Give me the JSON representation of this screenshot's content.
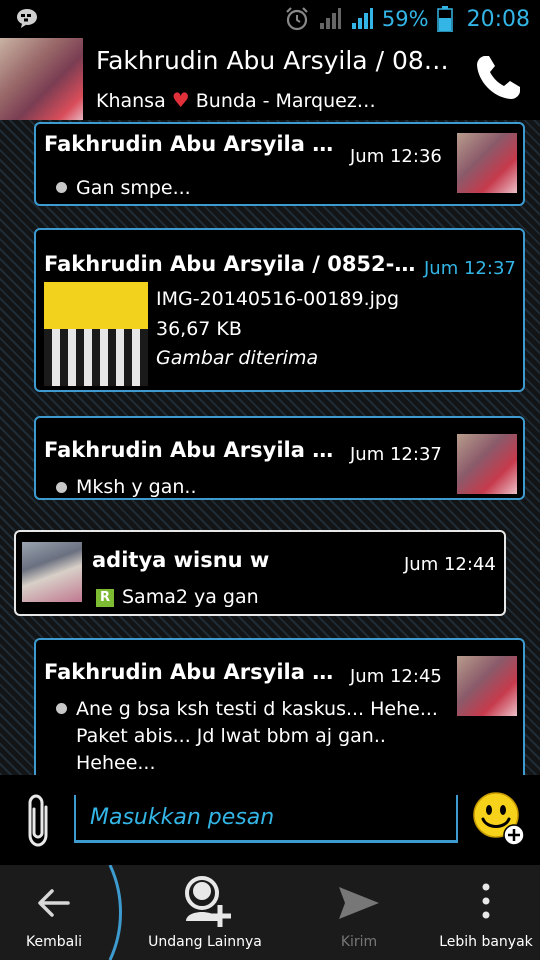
{
  "status_bar": {
    "battery_text": "59%",
    "time": "20:08"
  },
  "header": {
    "title": "Fakhrudin Abu Arsyila / 08…",
    "subtitle_before": "Khansa ",
    "subtitle_heart": "♥",
    "subtitle_after": " Bunda - Marquez…"
  },
  "messages": [
    {
      "name": "Fakhrudin Abu Arsyila /…",
      "time": "Jum 12:36",
      "text": "Gan smpe..."
    },
    {
      "name": "Fakhrudin Abu Arsyila / 0852-50…",
      "time": "Jum 12:37",
      "file_name": "IMG-20140516-00189.jpg",
      "file_size": "36,67 KB",
      "file_status": "Gambar diterima"
    },
    {
      "name": "Fakhrudin Abu Arsyila /…",
      "time": "Jum 12:37",
      "text": "Mksh y gan.."
    },
    {
      "name": "aditya wisnu w",
      "time": "Jum 12:44",
      "badge": "R",
      "text": "Sama2 ya gan"
    },
    {
      "name": "Fakhrudin Abu Arsyila /…",
      "time": "Jum 12:45",
      "text_lines": [
        "Ane g bsa ksh testi d kaskus... Hehe...",
        "Paket abis... Jd lwat bbm aj gan..",
        "Hehee..."
      ]
    }
  ],
  "input": {
    "placeholder": "Masukkan pesan"
  },
  "bottom_nav": {
    "back": "Kembali",
    "invite": "Undang Lainnya",
    "send": "Kirim",
    "more": "Lebih banyak"
  },
  "colors": {
    "accent": "#33b5e5",
    "bubble_border": "#3d9bd0",
    "heart": "#e0303a",
    "badge": "#7cbb32"
  }
}
